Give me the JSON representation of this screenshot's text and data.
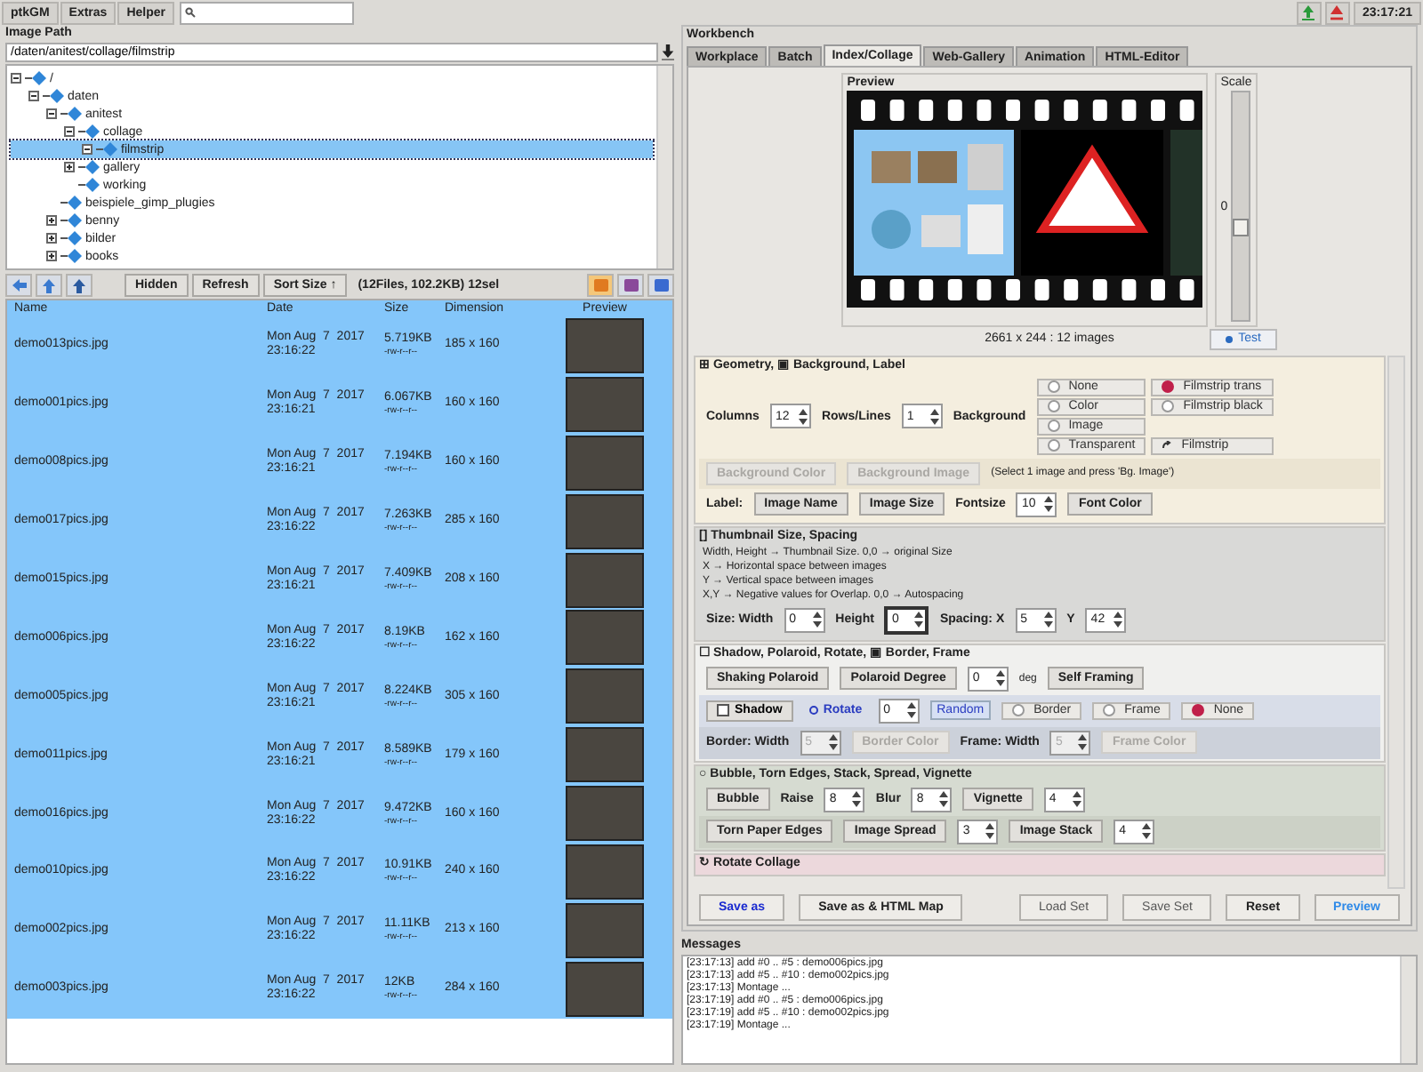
{
  "menu": [
    {
      "label": "ptkGM"
    },
    {
      "label": "Extras"
    },
    {
      "label": "Helper"
    }
  ],
  "tray": {
    "clock": "23:17:21"
  },
  "image_path": {
    "title": "Image Path",
    "value": "/daten/anitest/collage/filmstrip"
  },
  "tree": [
    {
      "label": "/",
      "expanded": true,
      "selected": false,
      "children": [
        {
          "label": "daten",
          "expanded": true,
          "selected": false,
          "children": [
            {
              "label": "anitest",
              "expanded": true,
              "selected": false,
              "children": [
                {
                  "label": "collage",
                  "expanded": true,
                  "selected": false,
                  "children": [
                    {
                      "label": "filmstrip",
                      "expanded": true,
                      "selected": true
                    }
                  ]
                },
                {
                  "label": "gallery",
                  "expanded": false,
                  "selected": false
                },
                {
                  "label": "working",
                  "selected": false
                }
              ]
            },
            {
              "label": "beispiele_gimp_plugies",
              "selected": false
            },
            {
              "label": "benny",
              "expanded": false,
              "selected": false
            },
            {
              "label": "bilder",
              "expanded": false,
              "selected": false
            },
            {
              "label": "books",
              "expanded": false,
              "selected": false
            }
          ]
        }
      ]
    }
  ],
  "file_toolbar": {
    "buttons": [
      {
        "label": "Hidden"
      },
      {
        "label": "Refresh"
      },
      {
        "label": "Sort Size ↑"
      }
    ],
    "status": "(12Files, 102.2KB) 12sel",
    "views": [
      {
        "selected": true
      },
      {
        "selected": false
      },
      {
        "selected": false
      }
    ]
  },
  "files": {
    "columns": [
      "Name",
      "Date",
      "Size",
      "Dimension",
      "Preview"
    ],
    "rows": [
      {
        "name": "demo013pics.jpg",
        "date": "Mon Aug  7  2017",
        "time": "23:16:22",
        "size": "5.719KB",
        "perms": "-rw-r--r--",
        "dimension": "185 x 160",
        "selected": true
      },
      {
        "name": "demo001pics.jpg",
        "date": "Mon Aug  7  2017",
        "time": "23:16:21",
        "size": "6.067KB",
        "perms": "-rw-r--r--",
        "dimension": "160 x 160",
        "selected": true
      },
      {
        "name": "demo008pics.jpg",
        "date": "Mon Aug  7  2017",
        "time": "23:16:21",
        "size": "7.194KB",
        "perms": "-rw-r--r--",
        "dimension": "160 x 160",
        "selected": true
      },
      {
        "name": "demo017pics.jpg",
        "date": "Mon Aug  7  2017",
        "time": "23:16:22",
        "size": "7.263KB",
        "perms": "-rw-r--r--",
        "dimension": "285 x 160",
        "selected": true
      },
      {
        "name": "demo015pics.jpg",
        "date": "Mon Aug  7  2017",
        "time": "23:16:21",
        "size": "7.409KB",
        "perms": "-rw-r--r--",
        "dimension": "208 x 160",
        "selected": true
      },
      {
        "name": "demo006pics.jpg",
        "date": "Mon Aug  7  2017",
        "time": "23:16:22",
        "size": "8.19KB",
        "perms": "-rw-r--r--",
        "dimension": "162 x 160",
        "selected": true
      },
      {
        "name": "demo005pics.jpg",
        "date": "Mon Aug  7  2017",
        "time": "23:16:21",
        "size": "8.224KB",
        "perms": "-rw-r--r--",
        "dimension": "305 x 160",
        "selected": true
      },
      {
        "name": "demo011pics.jpg",
        "date": "Mon Aug  7  2017",
        "time": "23:16:21",
        "size": "8.589KB",
        "perms": "-rw-r--r--",
        "dimension": "179 x 160",
        "selected": true
      },
      {
        "name": "demo016pics.jpg",
        "date": "Mon Aug  7  2017",
        "time": "23:16:22",
        "size": "9.472KB",
        "perms": "-rw-r--r--",
        "dimension": "160 x 160",
        "selected": true
      },
      {
        "name": "demo010pics.jpg",
        "date": "Mon Aug  7  2017",
        "time": "23:16:22",
        "size": "10.91KB",
        "perms": "-rw-r--r--",
        "dimension": "240 x 160",
        "selected": true
      },
      {
        "name": "demo002pics.jpg",
        "date": "Mon Aug  7  2017",
        "time": "23:16:22",
        "size": "11.11KB",
        "perms": "-rw-r--r--",
        "dimension": "213 x 160",
        "selected": true
      },
      {
        "name": "demo003pics.jpg",
        "date": "Mon Aug  7  2017",
        "time": "23:16:22",
        "size": "12KB",
        "perms": "-rw-r--r--",
        "dimension": "284 x 160",
        "selected": true
      }
    ]
  },
  "workbench": {
    "title": "Workbench",
    "tabs": [
      {
        "label": "Workplace",
        "selected": false
      },
      {
        "label": "Batch",
        "selected": false
      },
      {
        "label": "Index/Collage",
        "selected": true
      },
      {
        "label": "Web-Gallery",
        "selected": false
      },
      {
        "label": "Animation",
        "selected": false
      },
      {
        "label": "HTML-Editor",
        "selected": false
      }
    ]
  },
  "preview": {
    "title": "Preview",
    "scale": {
      "title": "Scale",
      "value": "0",
      "level": 0.4
    },
    "info": "2661 x 244 : 12 images",
    "test_button": "Test"
  },
  "sections": [
    {
      "kind": "geometry",
      "title": "⊞ Geometry, ▣ Background, Label",
      "rows": [
        {
          "items": [
            {
              "kind": "label",
              "text": "Columns"
            },
            {
              "kind": "spin",
              "value": "12"
            },
            {
              "kind": "label",
              "text": "Rows/Lines"
            },
            {
              "kind": "spin",
              "value": "1"
            },
            {
              "kind": "label",
              "text": "Background"
            },
            {
              "kind": "radio_grid",
              "columns": [
                [
                  {
                    "label": "None",
                    "selected": false
                  },
                  {
                    "label": "Color",
                    "selected": false
                  },
                  {
                    "label": "Image",
                    "selected": false
                  },
                  {
                    "label": "Transparent",
                    "selected": false
                  }
                ],
                [
                  {
                    "label": "Filmstrip trans",
                    "selected": true
                  },
                  {
                    "label": "Filmstrip black",
                    "selected": false
                  }
                ]
              ],
              "button": "Filmstrip"
            }
          ]
        },
        {
          "items": [
            {
              "kind": "button",
              "label": "Background Color",
              "disabled": true
            },
            {
              "kind": "button",
              "label": "Background Image",
              "disabled": true
            },
            {
              "kind": "text",
              "text": "(Select 1 image and press 'Bg. Image')"
            }
          ]
        },
        {
          "items": [
            {
              "kind": "label",
              "text": "Label:"
            },
            {
              "kind": "button",
              "label": "Image Name"
            },
            {
              "kind": "button",
              "label": "Image Size"
            },
            {
              "kind": "label",
              "text": "Fontsize"
            },
            {
              "kind": "spin",
              "value": "10"
            },
            {
              "kind": "button",
              "label": "Font Color"
            }
          ]
        }
      ]
    },
    {
      "kind": "thumbnail",
      "title": "[] Thumbnail Size, Spacing",
      "notes": [
        "Width, Height → Thumbnail Size. 0,0 → original Size",
        "X → Horizontal space between images",
        "Y → Vertical space between images",
        "X,Y → Negative values for Overlap. 0,0 → Autospacing"
      ],
      "rows": [
        {
          "items": [
            {
              "kind": "label",
              "text": "Size: Width"
            },
            {
              "kind": "spin",
              "value": "0",
              "focused": false
            },
            {
              "kind": "label",
              "text": "Height"
            },
            {
              "kind": "spin",
              "value": "0",
              "focused": true
            },
            {
              "kind": "label",
              "text": "Spacing: X"
            },
            {
              "kind": "spin",
              "value": "5",
              "focused": false
            },
            {
              "kind": "label",
              "text": "Y"
            },
            {
              "kind": "spin",
              "value": "42",
              "focused": false
            }
          ]
        }
      ]
    },
    {
      "kind": "effects",
      "title": "☐ Shadow, Polaroid, Rotate, ▣ Border, Frame",
      "rows": [
        {
          "items": [
            {
              "kind": "button",
              "label": "Shaking Polaroid"
            },
            {
              "kind": "button",
              "label": "Polaroid Degree"
            },
            {
              "kind": "spin",
              "value": "0"
            },
            {
              "kind": "text",
              "text": "deg"
            },
            {
              "kind": "button",
              "label": "Self Framing"
            }
          ]
        },
        {
          "items": [
            {
              "kind": "checkbox",
              "label": "Shadow",
              "checked": false
            },
            {
              "kind": "toggle",
              "label": "Rotate"
            },
            {
              "kind": "spin",
              "value": "0"
            },
            {
              "kind": "chip",
              "label": "Random"
            },
            {
              "kind": "radio",
              "label": "Border",
              "selected": false
            },
            {
              "kind": "radio",
              "label": "Frame",
              "selected": false
            },
            {
              "kind": "radio",
              "label": "None",
              "selected": true
            }
          ]
        },
        {
          "items": [
            {
              "kind": "label",
              "text": "Border: Width"
            },
            {
              "kind": "spin",
              "value": "5",
              "disabled": true
            },
            {
              "kind": "button",
              "label": "Border Color",
              "disabled": true
            },
            {
              "kind": "label",
              "text": "Frame: Width"
            },
            {
              "kind": "spin",
              "value": "5",
              "disabled": true
            },
            {
              "kind": "button",
              "label": "Frame Color",
              "disabled": true
            }
          ]
        }
      ]
    },
    {
      "kind": "bubble",
      "title": "○ Bubble, Torn Edges, Stack, Spread, Vignette",
      "rows": [
        {
          "items": [
            {
              "kind": "button",
              "label": "Bubble"
            },
            {
              "kind": "label",
              "text": "Raise"
            },
            {
              "kind": "spin",
              "value": "8"
            },
            {
              "kind": "label",
              "text": "Blur"
            },
            {
              "kind": "spin",
              "value": "8"
            },
            {
              "kind": "button",
              "label": "Vignette"
            },
            {
              "kind": "spin",
              "value": "4"
            }
          ]
        },
        {
          "items": [
            {
              "kind": "button",
              "label": "Torn Paper Edges"
            },
            {
              "kind": "button",
              "label": "Image Spread"
            },
            {
              "kind": "spin",
              "value": "3"
            },
            {
              "kind": "button",
              "label": "Image Stack"
            },
            {
              "kind": "spin",
              "value": "4"
            }
          ]
        }
      ]
    },
    {
      "kind": "rotate",
      "title": "↻ Rotate Collage"
    }
  ],
  "bottom_bar": {
    "left": [
      {
        "label": "Save as",
        "kind": "action"
      },
      {
        "label": "Save as & HTML Map",
        "kind": "strong"
      }
    ],
    "right": [
      {
        "label": "Load Set",
        "kind": "light"
      },
      {
        "label": "Save Set",
        "kind": "light"
      },
      {
        "label": "Reset",
        "kind": "strong"
      },
      {
        "label": "Preview",
        "kind": "preview"
      }
    ]
  },
  "messages": {
    "title": "Messages",
    "lines": [
      "[23:17:13] add #0 .. #5 : demo006pics.jpg",
      "[23:17:13] add #5 .. #10 : demo002pics.jpg",
      "[23:17:13] Montage ...",
      "[23:17:19] add #0 .. #5 : demo006pics.jpg",
      "[23:17:19] add #5 .. #10 : demo002pics.jpg",
      "[23:17:19] Montage ..."
    ]
  }
}
